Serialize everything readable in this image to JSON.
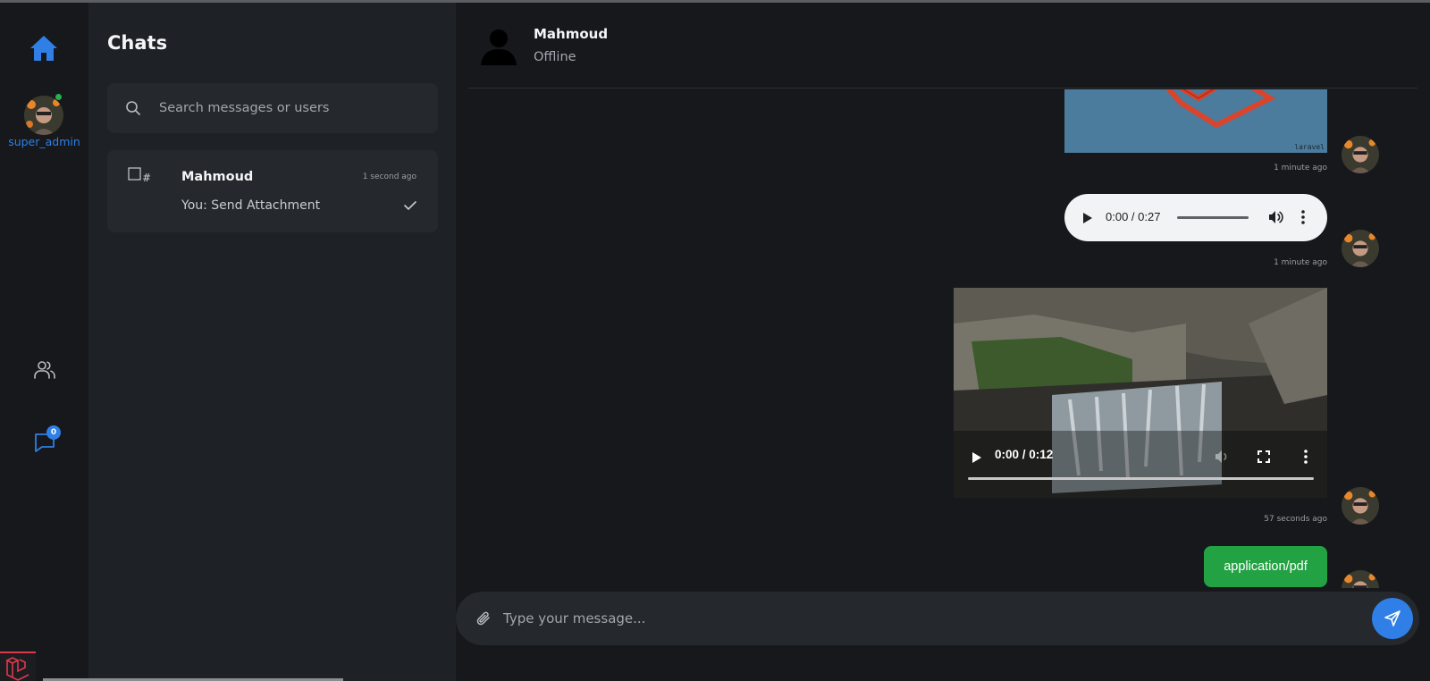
{
  "sidebar": {
    "username": "super_admin",
    "badge_count": "0"
  },
  "panel": {
    "title": "Chats",
    "search_placeholder": "Search messages or users",
    "chat_items": [
      {
        "icon_text": "#",
        "name": "Mahmoud",
        "time": "1 second ago",
        "last_message": "You: Send Attachment"
      }
    ]
  },
  "conversation": {
    "contact_name": "Mahmoud",
    "contact_status": "Offline",
    "messages": [
      {
        "type": "image",
        "caption": "laravel",
        "time": "1 minute ago"
      },
      {
        "type": "audio",
        "player_time": "0:00 / 0:27",
        "time": "1 minute ago"
      },
      {
        "type": "video",
        "player_time": "0:00 / 0:12",
        "time": "57 seconds ago"
      },
      {
        "type": "file",
        "label": "application/pdf"
      }
    ],
    "composer_placeholder": "Type your message..."
  },
  "colors": {
    "accent": "#2f7fe6",
    "online": "#22b14c",
    "file_button": "#23a244",
    "background": "#16181c",
    "panel": "#1e2125"
  },
  "icons": [
    "home-icon",
    "contacts-icon",
    "chat-bubble-icon",
    "search-icon",
    "check-icon",
    "paperclip-icon",
    "send-icon",
    "play-icon",
    "volume-icon",
    "fullscreen-icon",
    "more-options-icon",
    "laravel-logo-icon"
  ]
}
